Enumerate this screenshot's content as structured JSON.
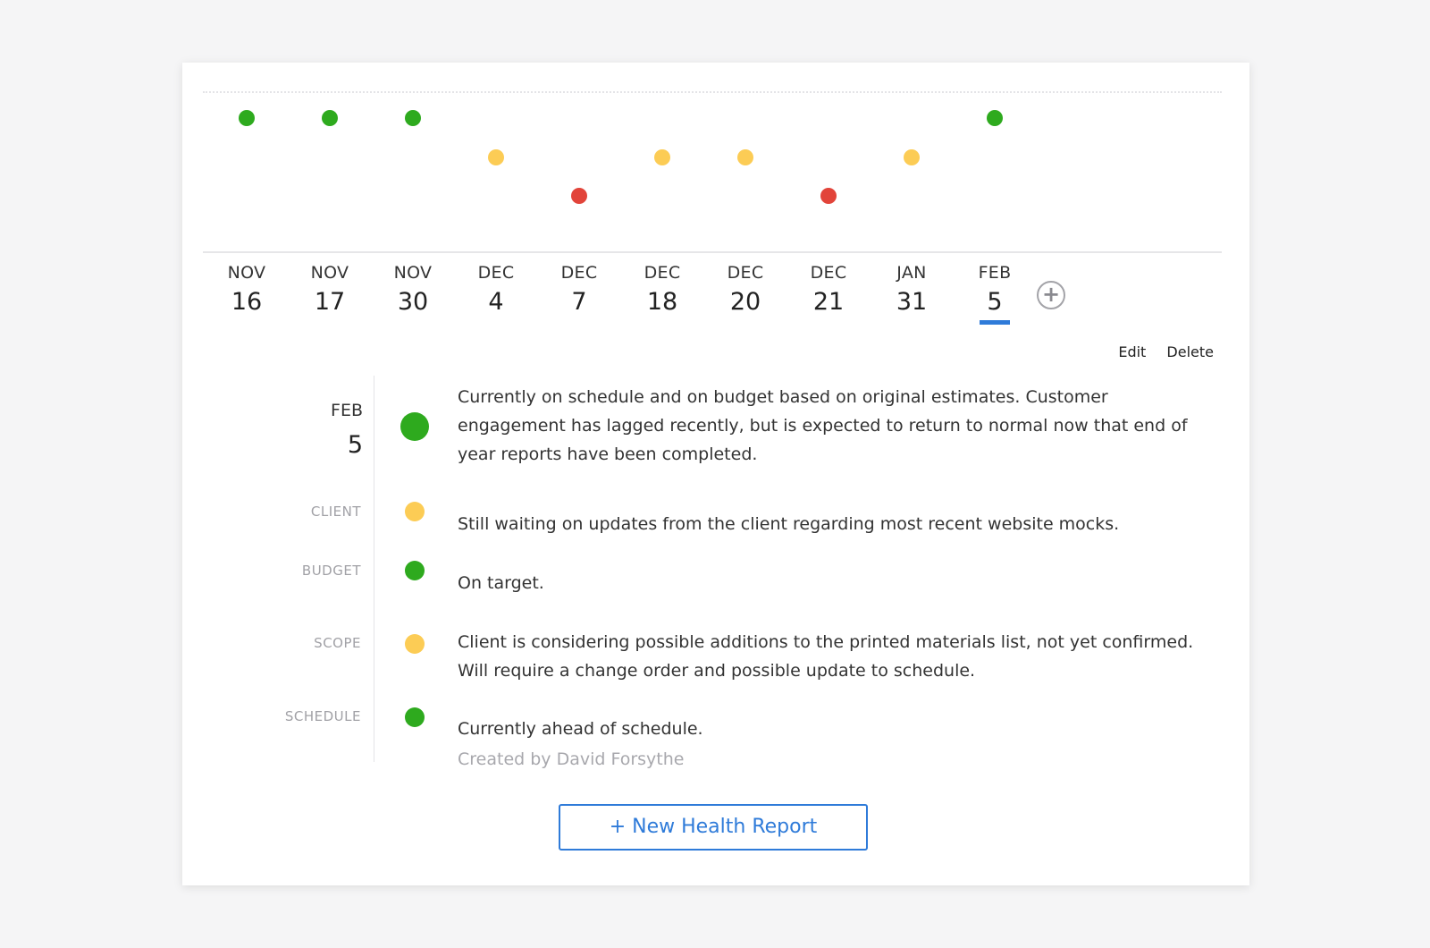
{
  "colors": {
    "green": "#2eaa1e",
    "yellow": "#fccc55",
    "red": "#e2443a",
    "accent": "#2f7bd9"
  },
  "timeline": {
    "entries": [
      {
        "month": "NOV",
        "day": "16",
        "status": "green"
      },
      {
        "month": "NOV",
        "day": "17",
        "status": "green"
      },
      {
        "month": "NOV",
        "day": "30",
        "status": "green"
      },
      {
        "month": "DEC",
        "day": "4",
        "status": "yellow"
      },
      {
        "month": "DEC",
        "day": "7",
        "status": "red"
      },
      {
        "month": "DEC",
        "day": "18",
        "status": "yellow"
      },
      {
        "month": "DEC",
        "day": "20",
        "status": "yellow"
      },
      {
        "month": "DEC",
        "day": "21",
        "status": "red"
      },
      {
        "month": "JAN",
        "day": "31",
        "status": "yellow"
      },
      {
        "month": "FEB",
        "day": "5",
        "status": "green",
        "selected": true
      }
    ],
    "add_icon": "plus-circle-icon"
  },
  "actions": {
    "edit": "Edit",
    "delete": "Delete"
  },
  "detail": {
    "month": "FEB",
    "day": "5",
    "summary": {
      "status": "green",
      "text": "Currently on schedule and on budget based on original estimates. Customer engagement has lagged recently, but is expected to return to normal now that end of year reports have been completed."
    },
    "rows": [
      {
        "label": "CLIENT",
        "status": "yellow",
        "text": "Still waiting on updates from the client regarding most recent website mocks."
      },
      {
        "label": "BUDGET",
        "status": "green",
        "text": "On target."
      },
      {
        "label": "SCOPE",
        "status": "yellow",
        "text": "Client is considering possible additions to the printed materials list, not yet confirmed. Will require a change order and possible update to schedule."
      },
      {
        "label": "SCHEDULE",
        "status": "green",
        "text": "Currently ahead of schedule."
      }
    ],
    "created_by": "Created by David Forsythe"
  },
  "new_report_button": "+ New Health Report"
}
